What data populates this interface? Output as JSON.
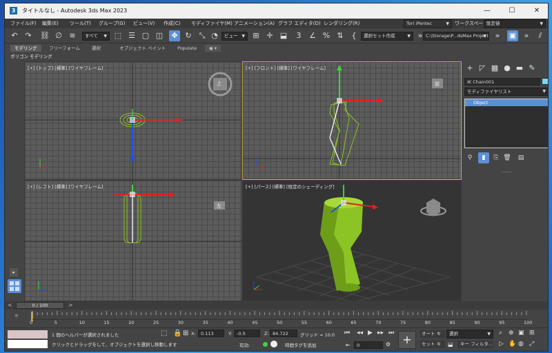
{
  "window": {
    "title": "タイトルなし - Autodesk 3ds Max 2023",
    "app_icon": "3",
    "minimize": "—",
    "maximize": "☐",
    "close": "✕"
  },
  "menubar": {
    "items": [
      "ファイル(F)",
      "編集(E)",
      "ツール(T)",
      "グループ(G)",
      "ビュー(V)",
      "作成(C)",
      "モディファイヤ(M)",
      "アニメーション(A)",
      "グラフ エディタ(D)",
      "レンダリング(R)"
    ],
    "user": "Tori iPentec",
    "workspace_label": "ワークスペース:",
    "workspace_value": "既定値"
  },
  "toolbar": {
    "selection_filter": "すべて",
    "view_coord": "ビュー",
    "selection_set": "選択セット作成",
    "project_path": "C:\\Storage\\P...dsMax Project"
  },
  "ribbon": {
    "tabs": [
      "モデリング",
      "フリーフォーム",
      "選択",
      "オブジェクト ペイント",
      "Populate"
    ],
    "sub_label": "ポリゴン モデリング"
  },
  "viewports": {
    "top": "[+] [トップ] [標準] [ワイヤフレーム]",
    "front": "[+] [フロント] [標準] [ワイヤフレーム]",
    "left": "[+] [レフト] [標準] [ワイヤフレーム]",
    "persp": "[+] [パース] [標準] [既定のシェーディング]",
    "cube_top": "上",
    "cube_front": "前",
    "cube_left": "左"
  },
  "command_panel": {
    "object_name": "IK Chain001",
    "modifier_list": "モディファイヤリスト",
    "stack_item": "Object",
    "name_color": "#7fd6f0"
  },
  "timeline": {
    "frame_label": "0 / 100",
    "ticks": [
      "0",
      "5",
      "10",
      "15",
      "20",
      "25",
      "30",
      "35",
      "40",
      "45",
      "50",
      "55",
      "60",
      "65",
      "70",
      "75",
      "80",
      "85",
      "90",
      "95",
      "100"
    ]
  },
  "status": {
    "line1": "1 個のヘルパーが選択されました",
    "line2": "クリックとドラッグをして、オブジェクトを選択し移動します",
    "x_label": "X:",
    "x_value": "0.113",
    "y_label": "Y:",
    "y_value": "-0.0",
    "z_label": "Z:",
    "z_value": "84.722",
    "grid_label": "グリッド = 10.0",
    "enable_label": "有効:",
    "add_tag": "時間タグを追加",
    "auto_key": "オート キー",
    "set_key": "セット キー",
    "key_mode": "選択",
    "key_filter": "キー フィルタ...",
    "frame_value": "0"
  },
  "colors": {
    "accent": "#5b8fd6",
    "viewport_bg": "#5c5c5c",
    "object_green": "#8bc424",
    "active_border": "#c8a84a"
  }
}
